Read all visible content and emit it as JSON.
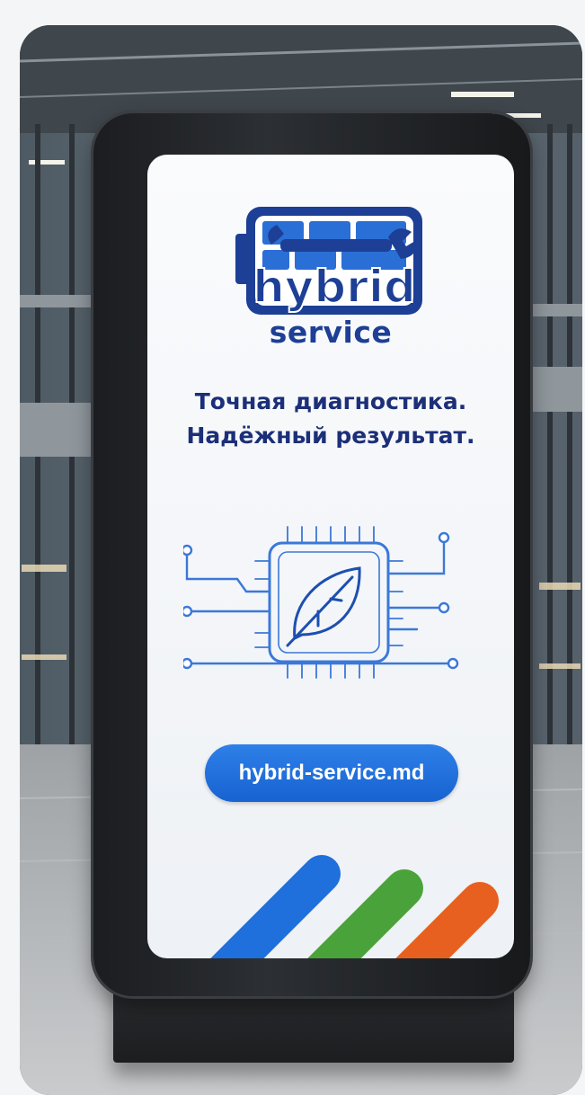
{
  "image": {
    "scene": "digital-signage-kiosk",
    "logo": {
      "word": "hybrid",
      "subword": "service",
      "icon": "wrench-icon"
    },
    "headline_line_1": "Точная диагностика.",
    "headline_line_2": "Надёжный результат.",
    "chip_icon": "leaf-icon",
    "website_label": "hybrid-service.md",
    "colors": {
      "brand_navy": "#1d3f95",
      "button_blue": "#1f6fdc",
      "stripe_blue": "#1f6fdc",
      "stripe_green": "#4aa33a",
      "stripe_orange": "#e8601f"
    }
  }
}
